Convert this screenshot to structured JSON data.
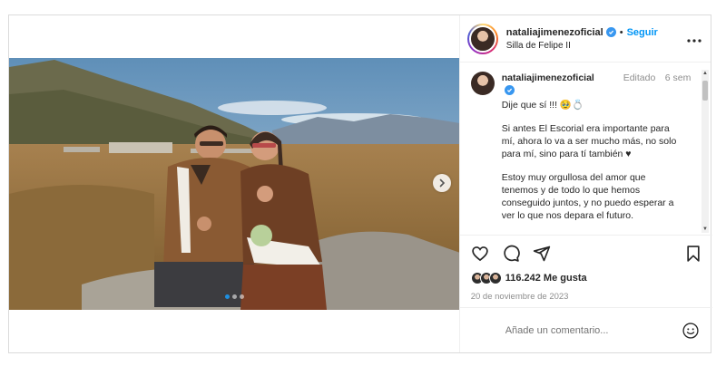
{
  "post": {
    "username": "nataliajimenezoficial",
    "follow_label": "Seguir",
    "separator": "•",
    "location": "Silla de Felipe II",
    "more_icon": "more-horizontal-icon",
    "verified_icon": "verified-badge-icon"
  },
  "caption": {
    "username": "nataliajimenezoficial",
    "edited": "Editado",
    "time_ago": "6 sem",
    "paragraphs": [
      "Dije que sí !!! 🥹💍",
      "Si antes El Escorial era importante para mí, ahora lo va a ser mucho más, no solo para mí, sino para tí también ♥",
      "Estoy muy orgullosa del amor que tenemos y de todo lo que hemos conseguido juntos, y no puedo esperar a ver lo que nos depara el futuro."
    ]
  },
  "actions": {
    "icons": [
      "heart-icon",
      "comment-icon",
      "share-icon",
      "bookmark-icon"
    ],
    "likes": "116.242 Me gusta",
    "date": "20 de noviembre de 2023"
  },
  "carousel": {
    "total_slides": 3,
    "current_slide": 1,
    "next_icon": "chevron-right-icon"
  },
  "comment": {
    "placeholder": "Añade un comentario...",
    "emoji_icon": "emoji-icon"
  },
  "colors": {
    "accent_blue": "#0095f6",
    "verified_blue": "#3897f0",
    "border": "#dbdbdb",
    "muted_text": "#8e8e8e"
  }
}
